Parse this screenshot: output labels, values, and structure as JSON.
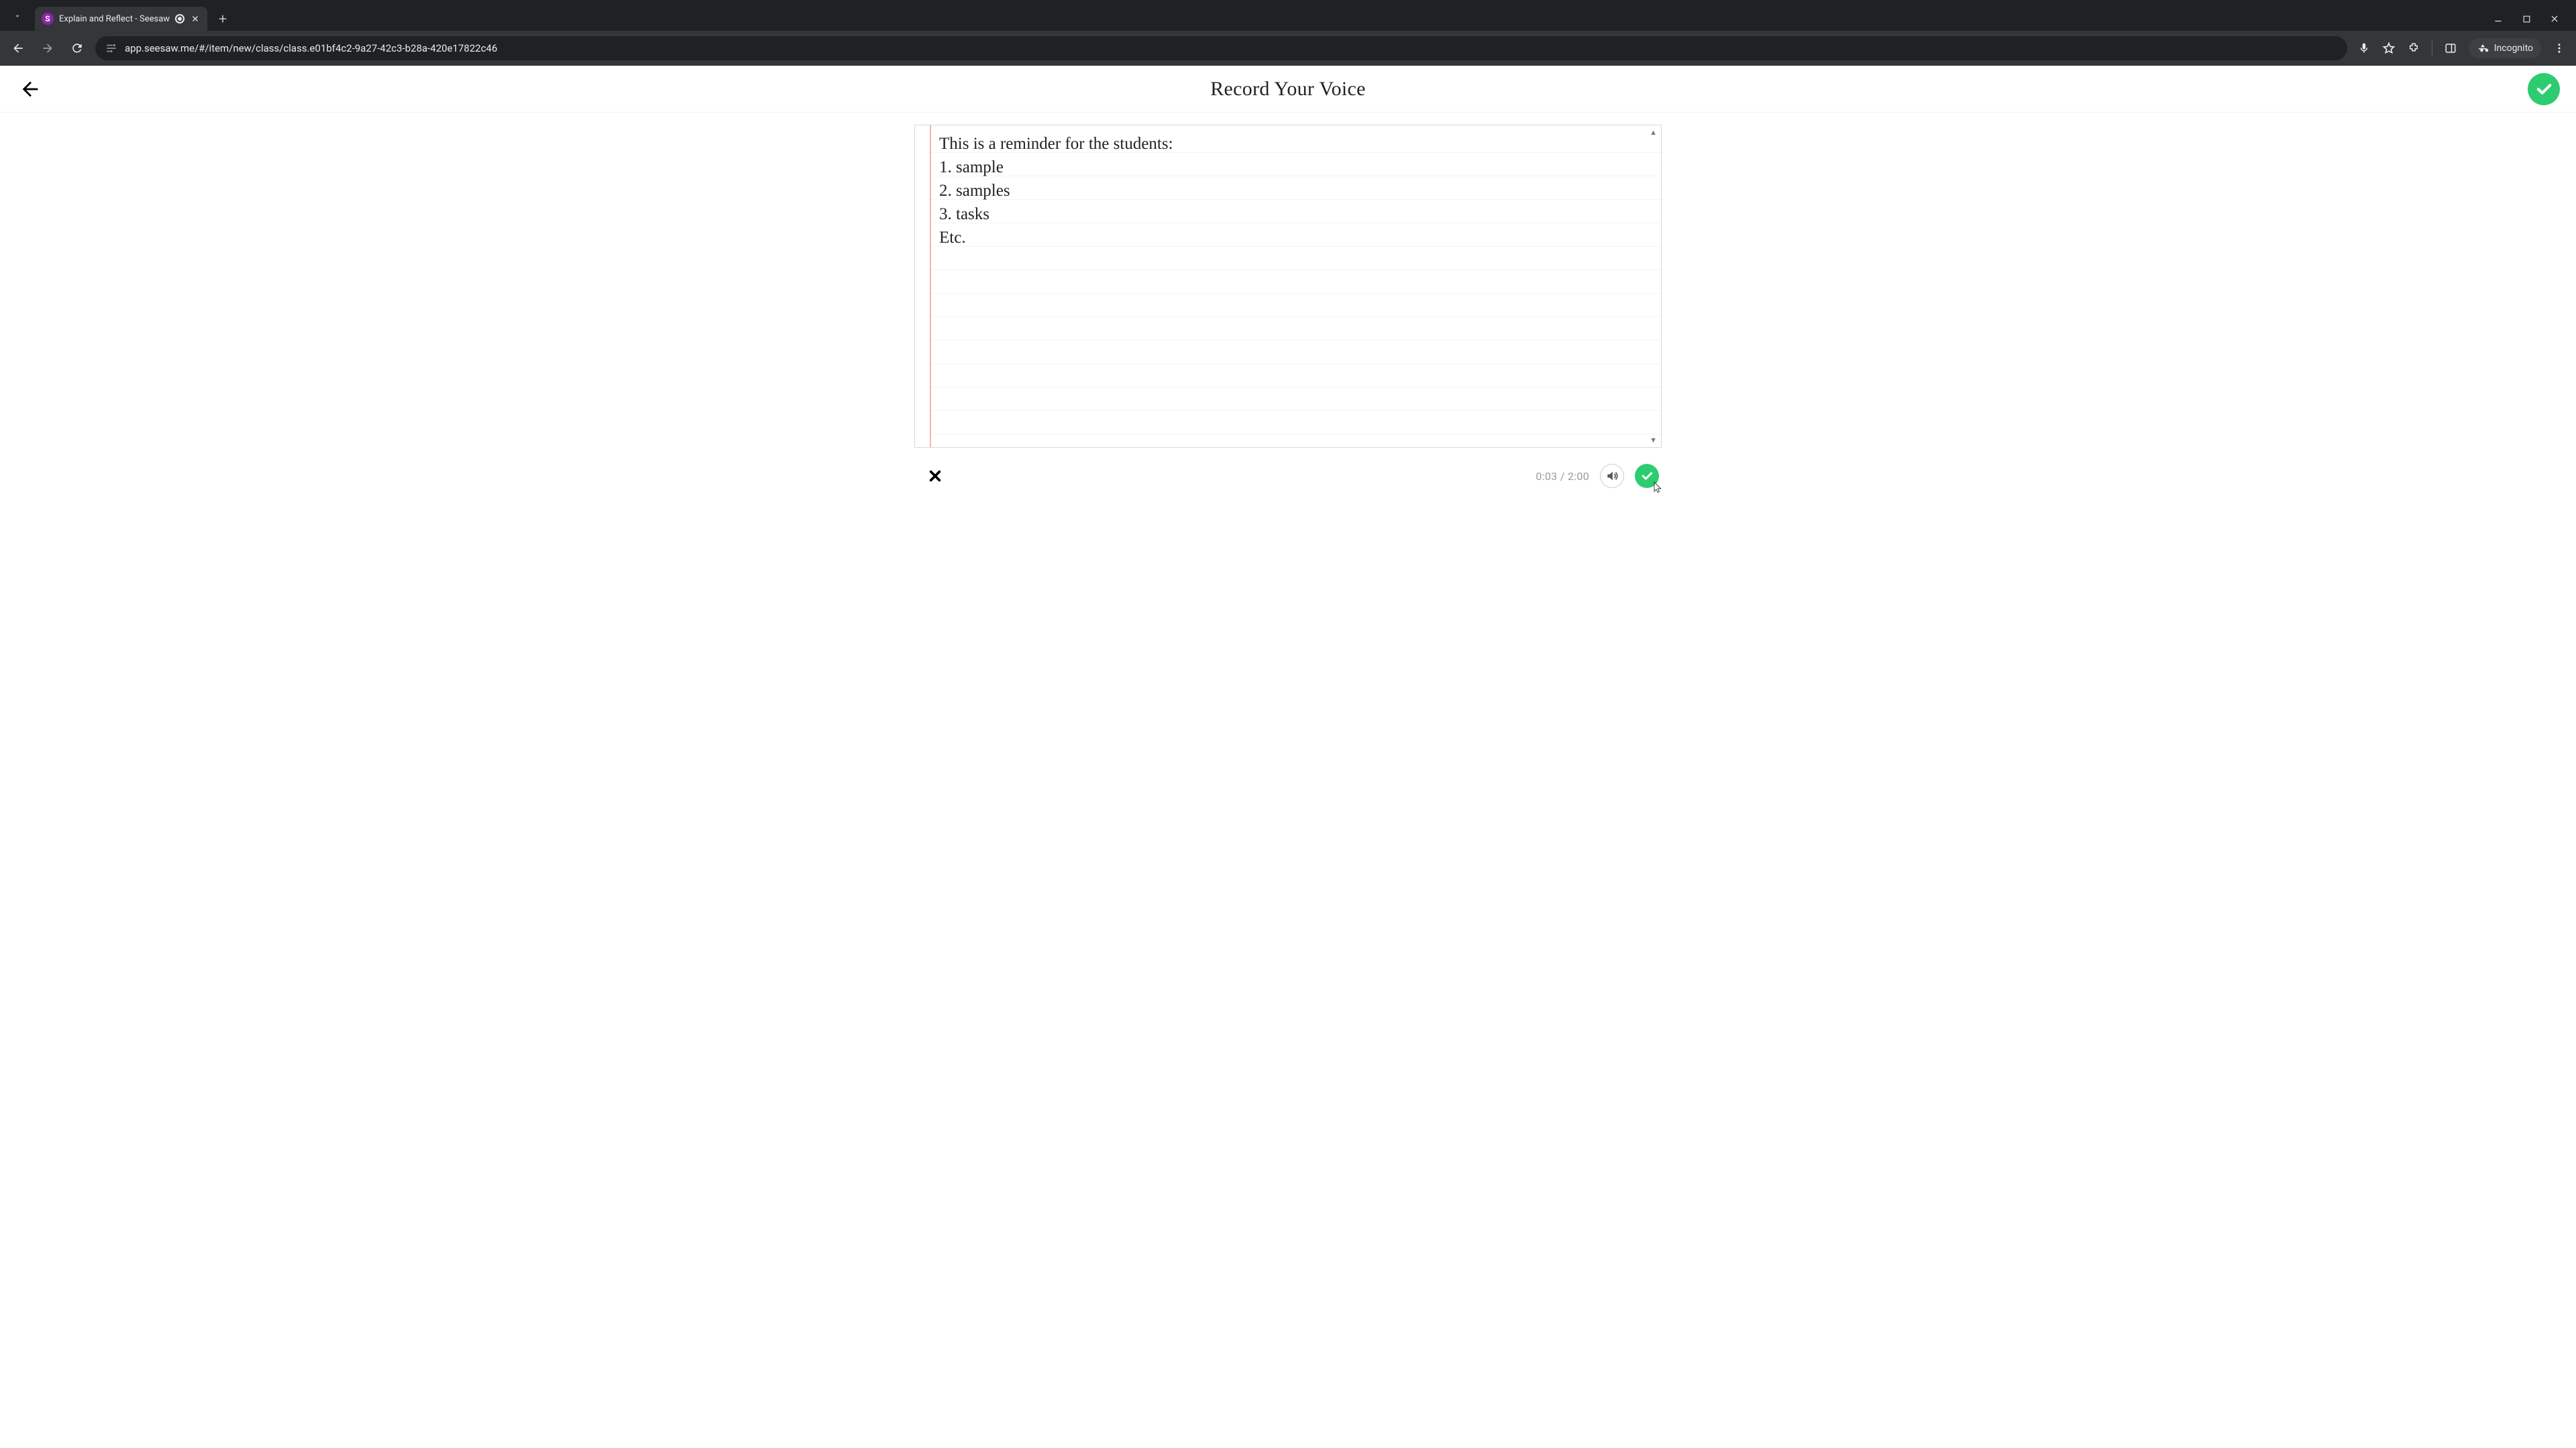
{
  "browser": {
    "tab": {
      "favicon_letter": "S",
      "title": "Explain and Reflect - Seesaw"
    },
    "url": "app.seesaw.me/#/item/new/class/class.e01bf4c2-9a27-42c3-b28a-420e17822c46",
    "incognito_label": "Incognito"
  },
  "header": {
    "title": "Record Your Voice"
  },
  "note": {
    "lines": [
      "This is a reminder for the students:",
      "1. sample",
      "2. samples",
      "3. tasks",
      "Etc."
    ]
  },
  "footer": {
    "elapsed": "0:03",
    "sep": " / ",
    "total": "2:00"
  },
  "colors": {
    "accent_green": "#2ecc71"
  }
}
